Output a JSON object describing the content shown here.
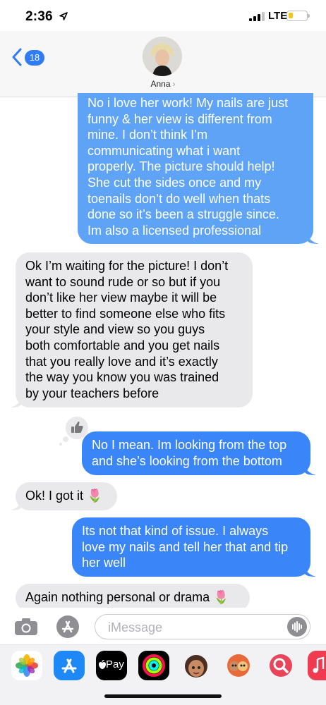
{
  "status_bar": {
    "time": "2:36",
    "network": "LTE",
    "battery_level": 0.25
  },
  "header": {
    "back_count": "18",
    "contact_name": "Anna",
    "contact_chevron": "›"
  },
  "messages": [
    {
      "type": "sent",
      "lines": [
        "No i love her work! My nails are just",
        "funny & her view is different from",
        "mine. I don’t think I’m",
        "communicating what i want",
        "properly. The picture should help!",
        "She cut the sides once and my",
        "toenails don’t do well when thats",
        "done so it’s been a struggle since.",
        "Im also a licensed professional"
      ]
    },
    {
      "type": "received",
      "lines": [
        "Ok I’m waiting for the picture! I don’t",
        "want to sound rude or so but if you",
        "don’t like her view maybe it will be",
        "better to find someone else who fits",
        "your style and view so you guys",
        "both comfortable and you get nails",
        "that you really love and it’s exactly",
        "the way you know you was trained",
        "by your teachers before"
      ]
    },
    {
      "type": "sent",
      "lines": [
        "No I mean. Im looking from the top",
        "and she’s looking from the bottom"
      ],
      "tapback": "thumbs-up"
    },
    {
      "type": "received",
      "lines": [
        "Ok! I got it 🌷"
      ]
    },
    {
      "type": "sent",
      "lines": [
        "Its not that kind of issue. I always",
        "love my nails and tell her that and tip",
        "her well"
      ]
    },
    {
      "type": "received",
      "lines": [
        "Again nothing personal or drama 🌷"
      ]
    }
  ],
  "compose": {
    "placeholder": "iMessage"
  },
  "app_drawer": [
    {
      "name": "photos-icon"
    },
    {
      "name": "app-store-icon"
    },
    {
      "name": "apple-pay-icon",
      "label": "Pay"
    },
    {
      "name": "activity-icon"
    },
    {
      "name": "memoji-icon"
    },
    {
      "name": "memoji-stickers-icon"
    },
    {
      "name": "search-images-icon"
    },
    {
      "name": "music-icon"
    }
  ],
  "colors": {
    "sent_bubble": "#3a85f7",
    "received_bubble": "#e9e9eb",
    "accent": "#2f7cf6"
  }
}
